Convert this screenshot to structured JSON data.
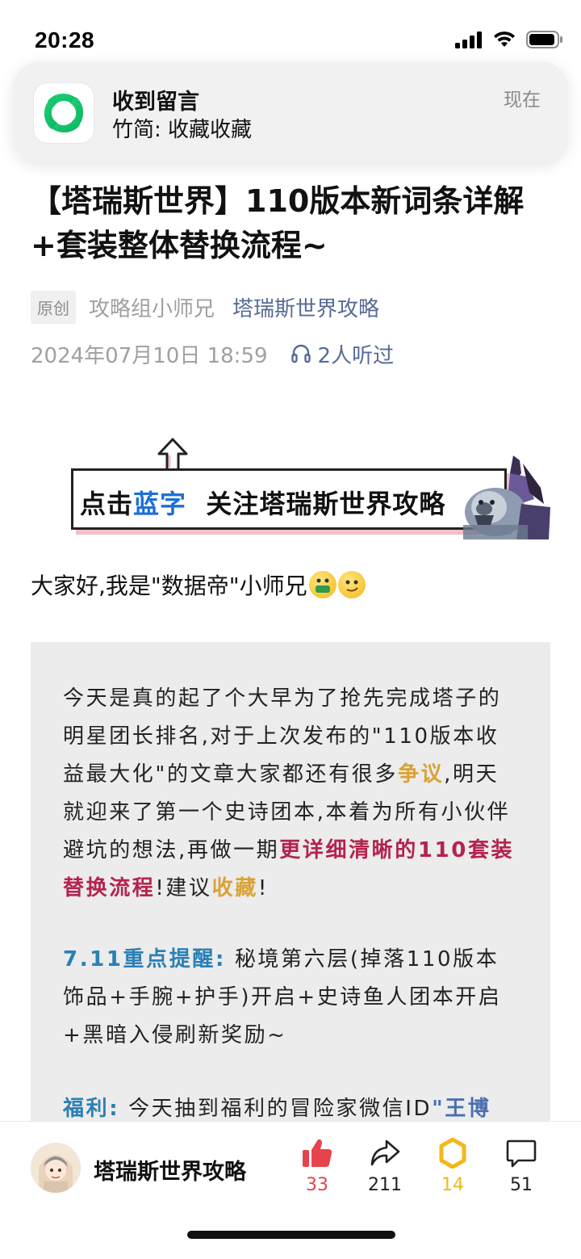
{
  "status_bar": {
    "time": "20:28"
  },
  "notification": {
    "title": "收到留言",
    "body": "竹简: 收藏收藏",
    "time": "现在",
    "app_icon": "wechat-channels-icon"
  },
  "article": {
    "title": "【塔瑞斯世界】110版本新词条详解+套装整体替换流程~",
    "badge": "原创",
    "author": "攻略组小师兄",
    "account": "塔瑞斯世界攻略",
    "date": "2024年07月10日 18:59",
    "listeners": "2人听过"
  },
  "follow_banner": {
    "prefix": "点击",
    "highlight": "蓝字",
    "suffix": "关注塔瑞斯世界攻略"
  },
  "greeting": "大家好,我是\"数据帝\"小师兄",
  "quote": {
    "p1_a": "今天是真的起了个大早为了抢先完成塔子的明星团长排名,对于上次发布的\"110版本收益最大化\"的文章大家都还有很多",
    "p1_b": "争议",
    "p1_c": ",明天就迎来了第一个史诗团本,本着为所有小伙伴避坑的想法,再做一期",
    "p1_d": "更详细清晰的110套装替换流程",
    "p1_e": "!建议",
    "p1_f": "收藏",
    "p1_g": "!",
    "p2_label": "7.11重点提醒:",
    "p2_text": " 秘境第六层(掉落110版本饰品+手腕+护手)开启+史诗鱼人团本开启+黑暗入侵刷新奖励~",
    "p3_label": "福利:",
    "p3_text": " 今天抽到福利的冒险家微信ID",
    "p3_id": "\"王博"
  },
  "bottom_bar": {
    "account_name": "塔瑞斯世界攻略",
    "like_count": "33",
    "share_count": "211",
    "favorite_count": "14",
    "comment_count": "51"
  },
  "colors": {
    "link": "#576b95",
    "like_red": "#e8434d",
    "favorite_yellow": "#f2b81c"
  }
}
